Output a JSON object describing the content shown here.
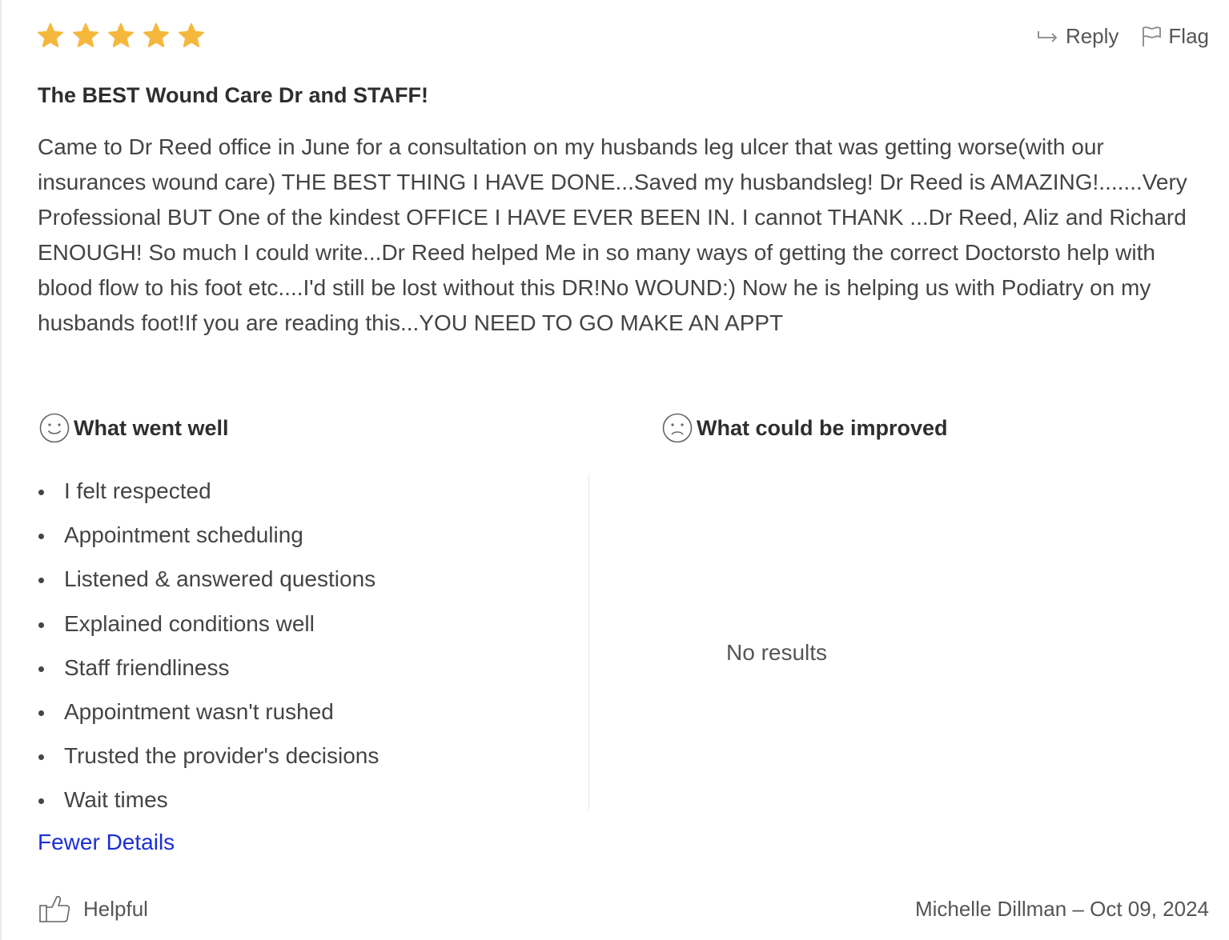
{
  "review": {
    "rating": 5,
    "rating_max": 5,
    "star_color": "#f5b83d",
    "title": "The BEST Wound Care Dr and STAFF!",
    "body": "Came to Dr Reed office in June for a consultation on my husbands leg ulcer that was getting worse(with our insurances wound care) THE BEST THING I HAVE DONE...Saved my husbandsleg! Dr Reed is AMAZING!.......Very Professional BUT One of the kindest OFFICE I HAVE EVER BEEN IN. I cannot THANK ...Dr Reed, Aliz and Richard ENOUGH! So much I could write...Dr Reed helped Me in so many ways of getting the correct Doctorsto help with blood flow to his foot etc....I'd still be lost without this DR!No WOUND:) Now he is helping us with Podiatry on my husbands foot!If you are reading this...YOU NEED TO GO MAKE AN APPT"
  },
  "actions": {
    "reply_label": "Reply",
    "reply_icon": "reply-arrow-icon",
    "flag_label": "Flag",
    "flag_icon": "flag-icon"
  },
  "went_well": {
    "heading": "What went well",
    "icon": "smile-face-icon",
    "items": [
      "I felt respected",
      "Appointment scheduling",
      "Listened & answered questions",
      "Explained conditions well",
      "Staff friendliness",
      "Appointment wasn't rushed",
      "Trusted the provider's decisions",
      "Wait times"
    ]
  },
  "could_improve": {
    "heading": "What could be improved",
    "icon": "frown-face-icon",
    "empty_text": "No results"
  },
  "fewer_details_label": "Fewer Details",
  "link_color": "#1b2fd6",
  "helpful": {
    "label": "Helpful",
    "icon": "thumbs-up-icon"
  },
  "byline": "Michelle Dillman – Oct 09, 2024"
}
